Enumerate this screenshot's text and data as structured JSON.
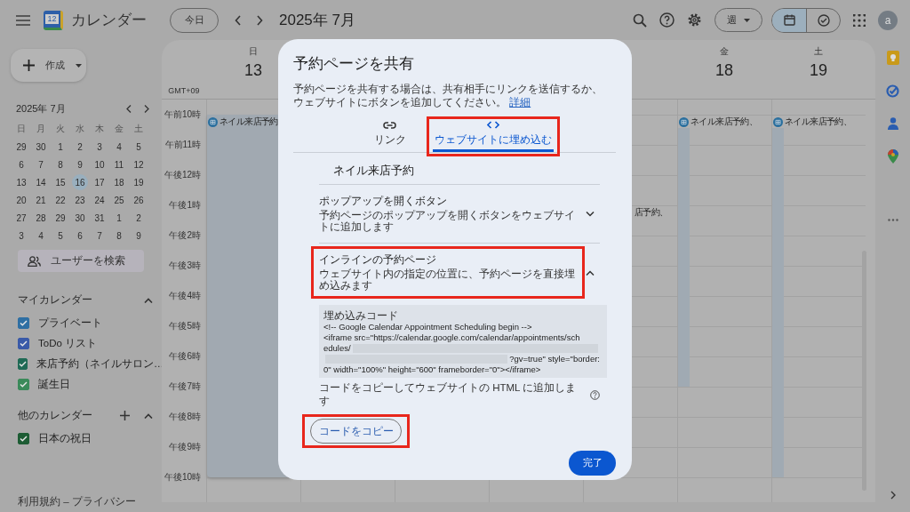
{
  "topbar": {
    "app_name": "カレンダー",
    "logo_day": "12",
    "today_button": "今日",
    "month_title": "2025年 7月",
    "view_select": "週",
    "avatar_letter": "a",
    "view_toggle": [
      {
        "kind": "calendar",
        "selected": true
      },
      {
        "kind": "tasks",
        "selected": false
      }
    ]
  },
  "sidebar": {
    "create_button": "作成",
    "mini_calendar": {
      "title": "2025年 7月",
      "weekdays": [
        "日",
        "月",
        "火",
        "水",
        "木",
        "金",
        "土"
      ],
      "weeks": [
        [
          {
            "day": "29",
            "selected": false
          },
          {
            "day": "30",
            "selected": false
          },
          {
            "day": "1",
            "selected": false
          },
          {
            "day": "2",
            "selected": false
          },
          {
            "day": "3",
            "selected": false
          },
          {
            "day": "4",
            "selected": false
          },
          {
            "day": "5",
            "selected": false
          }
        ],
        [
          {
            "day": "6",
            "selected": false
          },
          {
            "day": "7",
            "selected": false
          },
          {
            "day": "8",
            "selected": false
          },
          {
            "day": "9",
            "selected": false
          },
          {
            "day": "10",
            "selected": false
          },
          {
            "day": "11",
            "selected": false
          },
          {
            "day": "12",
            "selected": false
          }
        ],
        [
          {
            "day": "13",
            "selected": false
          },
          {
            "day": "14",
            "selected": false
          },
          {
            "day": "15",
            "selected": false
          },
          {
            "day": "16",
            "selected": true
          },
          {
            "day": "17",
            "selected": false
          },
          {
            "day": "18",
            "selected": false
          },
          {
            "day": "19",
            "selected": false
          }
        ],
        [
          {
            "day": "20",
            "selected": false
          },
          {
            "day": "21",
            "selected": false
          },
          {
            "day": "22",
            "selected": false
          },
          {
            "day": "23",
            "selected": false
          },
          {
            "day": "24",
            "selected": false
          },
          {
            "day": "25",
            "selected": false
          },
          {
            "day": "26",
            "selected": false
          }
        ],
        [
          {
            "day": "27",
            "selected": false
          },
          {
            "day": "28",
            "selected": false
          },
          {
            "day": "29",
            "selected": false
          },
          {
            "day": "30",
            "selected": false
          },
          {
            "day": "31",
            "selected": false
          },
          {
            "day": "1",
            "selected": false
          },
          {
            "day": "2",
            "selected": false
          }
        ],
        [
          {
            "day": "3",
            "selected": false
          },
          {
            "day": "4",
            "selected": false
          },
          {
            "day": "5",
            "selected": false
          },
          {
            "day": "6",
            "selected": false
          },
          {
            "day": "7",
            "selected": false
          },
          {
            "day": "8",
            "selected": false
          },
          {
            "day": "9",
            "selected": false
          }
        ]
      ]
    },
    "people_search": "ユーザーを検索",
    "my_calendars": {
      "title": "マイカレンダー",
      "expanded": true,
      "items": [
        {
          "label": "プライベート",
          "checked": true,
          "color": "#2f6fa3"
        },
        {
          "label": "ToDo リスト",
          "checked": true,
          "color": "#3a5aa8"
        },
        {
          "label": "来店予約（ネイルサロン…",
          "checked": true,
          "color": "#1f6a55"
        },
        {
          "label": "誕生日",
          "checked": true,
          "color": "#3b8a5a"
        }
      ]
    },
    "other_calendars": {
      "title": "他のカレンダー",
      "expanded": true,
      "items": [
        {
          "label": "日本の祝日",
          "checked": true,
          "color": "#1d5c34"
        }
      ]
    },
    "footer": "利用規約 – プライバシー"
  },
  "calendar": {
    "timezone": "GMT+09",
    "time_labels": [
      "午前10時",
      "午前11時",
      "午後12時",
      "午後1時",
      "午後2時",
      "午後3時",
      "午後4時",
      "午後5時",
      "午後6時",
      "午後7時",
      "午後8時",
      "午後9時",
      "午後10時"
    ],
    "columns": [
      {
        "weekday": "日",
        "day": "13",
        "covered": false,
        "events": [
          {
            "title": "ネイル来店予約",
            "selected": true
          }
        ]
      },
      {},
      {},
      {},
      {
        "covered": true,
        "events": [
          {
            "title": "店予約、",
            "selected": false
          }
        ]
      },
      {
        "weekday": "金",
        "day": "18",
        "covered": false,
        "events": [
          {
            "title": "ネイル来店予約、",
            "selected": false
          }
        ]
      },
      {
        "weekday": "土",
        "day": "19",
        "covered": false,
        "events": [
          {
            "title": "ネイル来店予約、",
            "selected": false
          }
        ]
      }
    ]
  },
  "dialog": {
    "title": "予約ページを共有",
    "description": "予約ページを共有する場合は、共有相手にリンクを送信するか、ウェブサイトにボタンを追加してください。",
    "learn_more_link": "詳細",
    "tabs": [
      {
        "label": "リンク",
        "selected": false,
        "highlighted": false
      },
      {
        "label": "ウェブサイトに埋め込む",
        "selected": true,
        "highlighted": true
      }
    ],
    "page_name": "ネイル来店予約",
    "sections": [
      {
        "title": "ポップアップを開くボタン",
        "subtitle": "予約ページのポップアップを開くボタンをウェブサイトに追加します",
        "expanded": false,
        "highlighted": false
      },
      {
        "title": "インラインの予約ページ",
        "subtitle": "ウェブサイト内の指定の位置に、予約ページを直接埋め込みます",
        "expanded": true,
        "highlighted": true
      }
    ],
    "embed": {
      "label": "埋め込みコード",
      "lines": [
        {
          "kind": "text",
          "text": "<!-- Google Calendar Appointment Scheduling begin -->"
        },
        {
          "kind": "text",
          "text": "<iframe src=\"https://calendar.google.com/calendar/appointments/sch"
        },
        {
          "kind": "redacted-after",
          "text": "edules/"
        },
        {
          "kind": "redacted-before",
          "text": "?gv=true\" style=\"border:"
        },
        {
          "kind": "text",
          "text": "0\" width=\"100%\" height=\"600\" frameborder=\"0\"></iframe>"
        }
      ],
      "hint": "コードをコピーしてウェブサイトの HTML に追加します",
      "copy_button": {
        "label": "コードをコピー",
        "highlighted": true
      }
    },
    "done_button": "完了"
  }
}
